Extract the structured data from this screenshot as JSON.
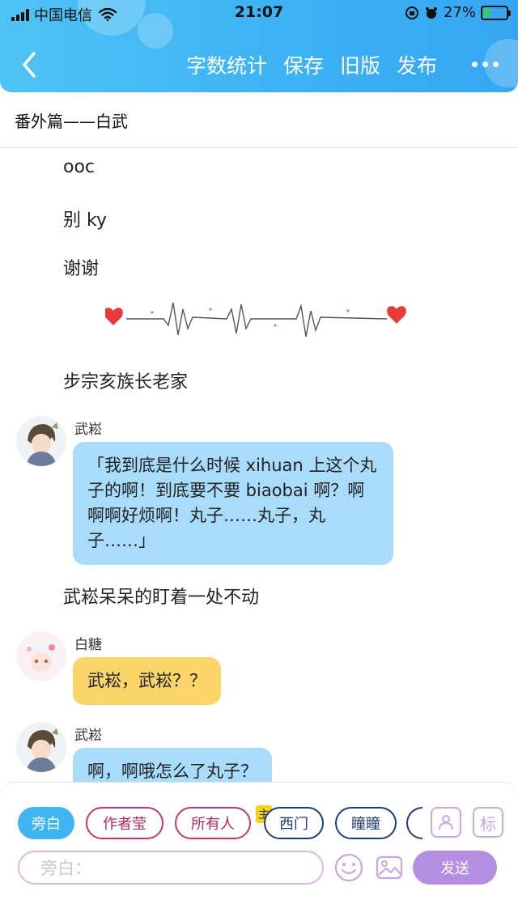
{
  "status_bar": {
    "carrier": "中国电信",
    "time": "21:07",
    "battery_text": "27%",
    "battery_level": 0.27,
    "battery_color": "#3ccf4e"
  },
  "nav": {
    "back_icon": "chevron-left-icon",
    "actions": [
      "字数统计",
      "保存",
      "旧版",
      "发布"
    ],
    "more_icon": "more-icon"
  },
  "chapter_title": "番外篇——白武",
  "content": {
    "narration": [
      "ooc",
      "别 ky",
      "谢谢",
      "步宗亥族长老家",
      "武崧呆呆的盯着一处不动"
    ],
    "messages": [
      {
        "name": "武崧",
        "text": "「我到底是什么时候 xihuan 上这个丸子的啊！到底要不要 biaobai 啊？啊啊啊好烦啊！丸子……丸子，丸子……」",
        "bubble_color": "#a8dcfa"
      },
      {
        "name": "白糖",
        "text": "武崧，武崧？？",
        "bubble_color": "#fbd56a"
      },
      {
        "name": "武崧",
        "text": "啊，啊哦怎么了丸子？",
        "bubble_color": "#a8dcfa"
      }
    ]
  },
  "composer": {
    "roles": [
      "旁白",
      "作者莹",
      "所有人",
      "西门",
      "瞳瞳"
    ],
    "host_badge": "主",
    "mark_label": "标",
    "input_placeholder": "旁白：",
    "send_label": "发送",
    "accent_color": "#3eb4f1"
  }
}
